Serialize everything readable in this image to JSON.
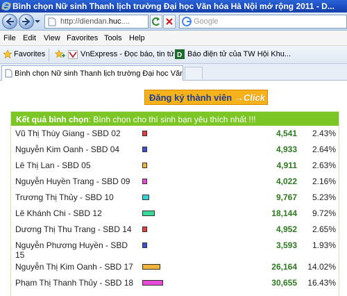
{
  "window": {
    "title": "Bình chọn Nữ sinh Thanh lịch trường Đại học Văn hóa Hà Nội mở rộng 2011 - D..."
  },
  "address": {
    "url_prefix": "http://diendan.",
    "url_bold": "huc",
    "url_suffix": "....",
    "search_placeholder": "Google"
  },
  "menu": [
    "File",
    "Edit",
    "View",
    "Favorites",
    "Tools",
    "Help"
  ],
  "favorites": {
    "label": "Favorites",
    "links": [
      "VnExpress - Đọc báo, tin tứ...",
      "Báo điện tử của TW Hội Khu..."
    ]
  },
  "tab": {
    "label": "Bình chọn Nữ sinh Thanh lịch trường Đại học Văn hóa ..."
  },
  "page": {
    "register_label": "Đăng ký thành viên",
    "register_click": "→Click",
    "poll_title_bold": "Kết quả bình chọn",
    "poll_title_rest": ": Bình chọn cho thí sinh bạn yêu thích nhất !!!",
    "candidates": [
      {
        "name": "Vũ Thị Thùy Giang - SBD 02",
        "votes": "4,541",
        "percent": "2.43%",
        "share": 2.43,
        "color": "#e0403a"
      },
      {
        "name": "Nguyễn Kim Oanh - SBD 04",
        "votes": "4,933",
        "percent": "2.64%",
        "share": 2.64,
        "color": "#3a4fd6"
      },
      {
        "name": "Lê Thị Lan - SBD 05",
        "votes": "4,911",
        "percent": "2.63%",
        "share": 2.63,
        "color": "#f0b43a"
      },
      {
        "name": "Nguyễn Huyền Trang - SBD 09",
        "votes": "4,022",
        "percent": "2.16%",
        "share": 2.16,
        "color": "#e84ad8"
      },
      {
        "name": "Trương Thị Thủy - SBD 10",
        "votes": "9,767",
        "percent": "5.23%",
        "share": 5.23,
        "color": "#36d0d6"
      },
      {
        "name": "Lê Khánh Chi - SBD 12",
        "votes": "18,144",
        "percent": "9.72%",
        "share": 9.72,
        "color": "#3ad89a"
      },
      {
        "name": "Dương Thị Thu Trang - SBD 14",
        "votes": "4,952",
        "percent": "2.65%",
        "share": 2.65,
        "color": "#e0403a"
      },
      {
        "name": "Nguyễn Phương Huyền - SBD 15",
        "votes": "3,593",
        "percent": "1.93%",
        "share": 1.93,
        "color": "#3a4fd6"
      },
      {
        "name": "Nguyễn Thị Kim Oanh - SBD 17",
        "votes": "26,164",
        "percent": "14.02%",
        "share": 14.02,
        "color": "#f0b43a"
      },
      {
        "name": "Phạm Thị Thanh Thủy - SBD 18",
        "votes": "30,655",
        "percent": "16.43%",
        "share": 16.43,
        "color": "#e84ad8"
      }
    ]
  }
}
